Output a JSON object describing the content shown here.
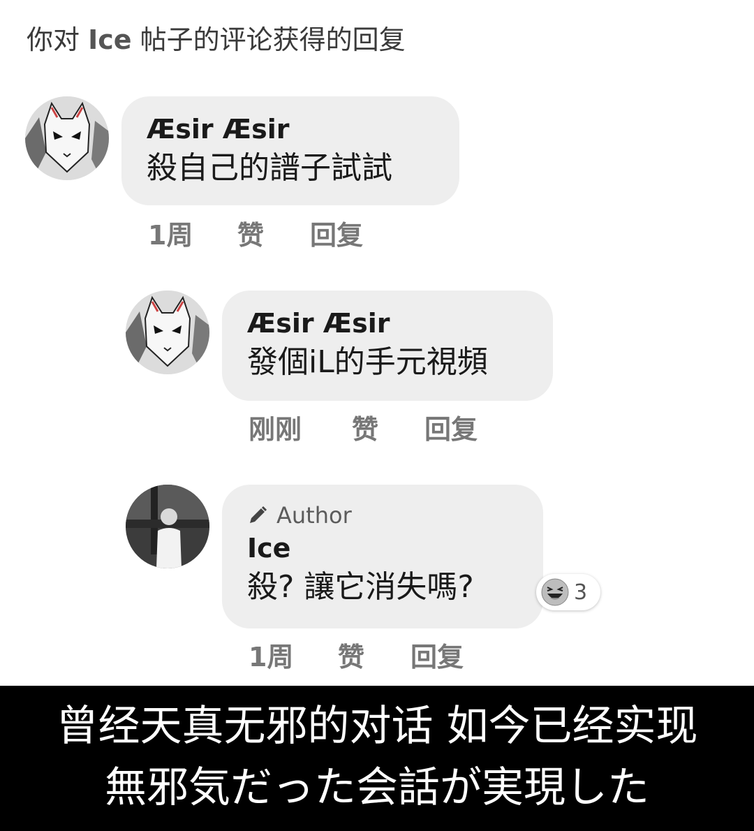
{
  "header": {
    "prefix": "你对 ",
    "author": "Ice",
    "suffix": " 帖子的评论获得的回复"
  },
  "comments": [
    {
      "name": "Æsir Æsir",
      "text": "殺自己的譜子試試",
      "time": "1周",
      "like": "赞",
      "reply": "回复"
    },
    {
      "name": "Æsir Æsir",
      "text": "發個iL的手元視頻",
      "time": "刚刚",
      "like": "赞",
      "reply": "回复"
    },
    {
      "author_tag": "Author",
      "name": "Ice",
      "text": "殺? 讓它消失嗎?",
      "time": "1周",
      "like": "赞",
      "reply": "回复",
      "reaction": {
        "icon": "laughing-emoji-icon",
        "count": "3"
      }
    }
  ],
  "caption": {
    "line1": "曾经天真无邪的对话 如今已经实现",
    "line2": "無邪気だった会話が実現した"
  }
}
